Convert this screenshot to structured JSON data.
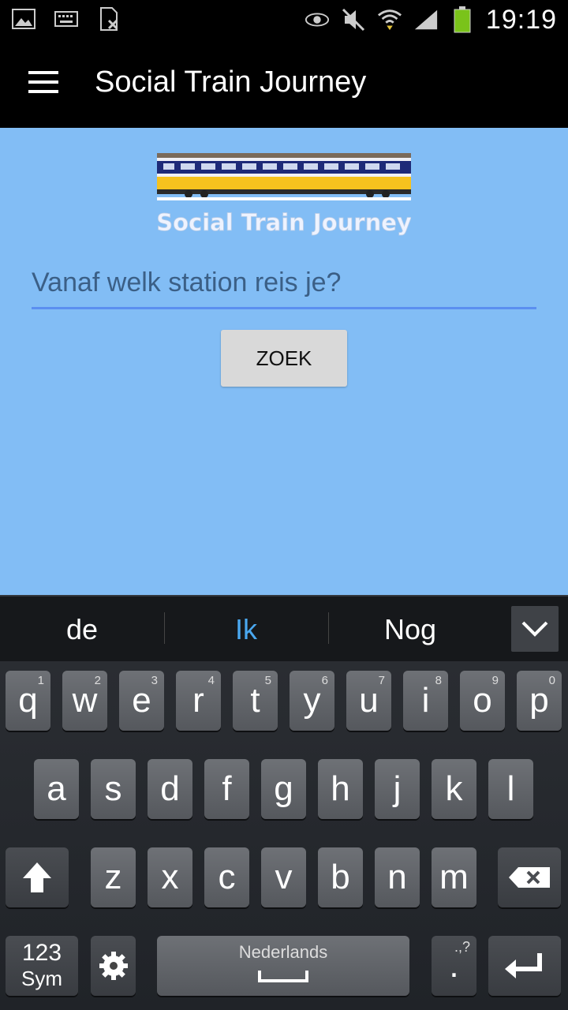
{
  "status": {
    "time": "19:19",
    "left_icons": [
      "image-icon",
      "keyboard-icon",
      "no-sim-icon"
    ],
    "right_icons": [
      "eye-icon",
      "mute-icon",
      "wifi-icon",
      "signal-icon",
      "battery-icon"
    ],
    "battery_color": "#7ac31a"
  },
  "appbar": {
    "title": "Social Train Journey"
  },
  "logo": {
    "text": "Social Train Journey"
  },
  "search": {
    "placeholder": "Vanaf welk station reis je?",
    "value": ""
  },
  "button": {
    "label": "ZOEK"
  },
  "keyboard": {
    "suggestions": [
      "de",
      "Ik",
      "Nog"
    ],
    "row1": [
      {
        "k": "q",
        "h": "1"
      },
      {
        "k": "w",
        "h": "2"
      },
      {
        "k": "e",
        "h": "3"
      },
      {
        "k": "r",
        "h": "4"
      },
      {
        "k": "t",
        "h": "5"
      },
      {
        "k": "y",
        "h": "6"
      },
      {
        "k": "u",
        "h": "7"
      },
      {
        "k": "i",
        "h": "8"
      },
      {
        "k": "o",
        "h": "9"
      },
      {
        "k": "p",
        "h": "0"
      }
    ],
    "row2": [
      "a",
      "s",
      "d",
      "f",
      "g",
      "h",
      "j",
      "k",
      "l"
    ],
    "row3": [
      "z",
      "x",
      "c",
      "v",
      "b",
      "n",
      "m"
    ],
    "sym_top": "123",
    "sym_bottom": "Sym",
    "space_lang": "Nederlands",
    "period": ".",
    "period_hint": ".,?"
  },
  "colors": {
    "content_bg": "#82bdf5",
    "accent_underline": "#5b8ff0",
    "suggestion_active": "#4aa8f0"
  }
}
